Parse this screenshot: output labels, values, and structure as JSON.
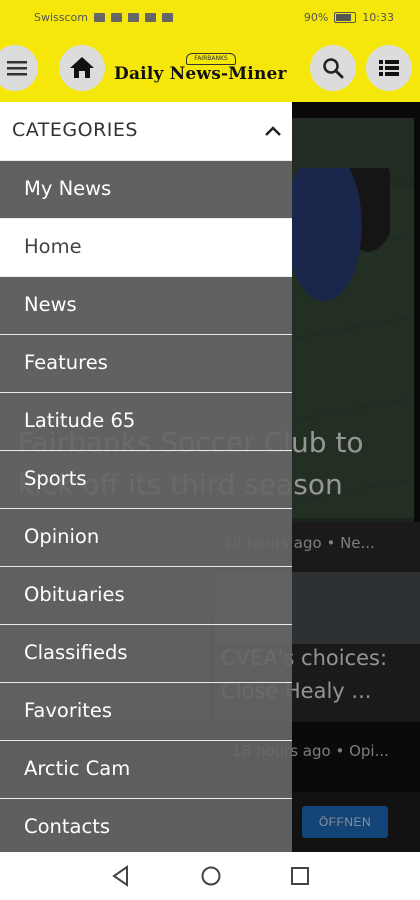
{
  "status_bar": {
    "carrier": "Swisscom",
    "battery": "90%",
    "time": "10:33"
  },
  "app_bar": {
    "logo_text": "Daily News-Miner",
    "logo_badge": "FAIRBANKS"
  },
  "drawer": {
    "header": "CATEGORIES",
    "items": [
      {
        "label": "My News"
      },
      {
        "label": "Home",
        "active": true
      },
      {
        "label": "News"
      },
      {
        "label": "Features"
      },
      {
        "label": "Latitude 65"
      },
      {
        "label": "Sports"
      },
      {
        "label": "Opinion"
      },
      {
        "label": "Obituaries"
      },
      {
        "label": "Classifieds"
      },
      {
        "label": "Favorites"
      },
      {
        "label": "Arctic Cam"
      },
      {
        "label": "Contacts"
      }
    ]
  },
  "background_content": {
    "headline": "Fairbanks Soccer Club to kick off its third season",
    "card2_meta": "18 hours ago • Ne...",
    "card2_title_line1": "CVEA's choices:",
    "card2_title_line2": "Close Healy ...",
    "card3_meta": "18 hours ago • Opi...",
    "ad_button": "ÖFFNEN"
  },
  "colors": {
    "brand_yellow": "#f6e70b",
    "drawer_item_bg": "#666666",
    "ad_button": "#1f6fc2"
  },
  "icons": {
    "menu": "hamburger-icon",
    "home": "home-icon",
    "search": "search-icon",
    "list": "list-icon",
    "collapse": "chevron-up-icon",
    "nav_back": "back-triangle-icon",
    "nav_home": "home-circle-icon",
    "nav_recent": "recent-square-icon"
  }
}
